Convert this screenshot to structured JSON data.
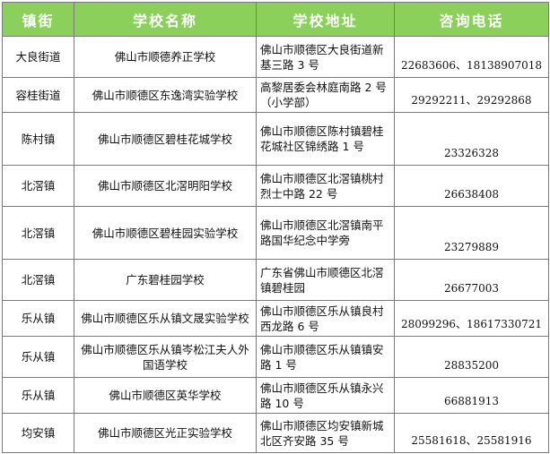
{
  "headers": [
    "镇街",
    "学校名称",
    "学校地址",
    "咨询电话"
  ],
  "rows": [
    {
      "town": "大良街道",
      "school": "佛山市顺德养正学校",
      "address": "佛山市顺德区大良街道新基三路 3 号",
      "phone": "22683606、18138907018"
    },
    {
      "town": "容桂街道",
      "school": "佛山市顺德区东逸湾实验学校",
      "address": "高黎居委会林庭南路 2 号（小学部）",
      "phone": "29292211、29292868"
    },
    {
      "town": "陈村镇",
      "school": "佛山市顺德区碧桂花城学校",
      "address": "佛山市顺德区陈村镇碧桂花城社区锦绣路 1 号",
      "phone": "23326328"
    },
    {
      "town": "北滘镇",
      "school": "佛山市顺德区北滘明阳学校",
      "address": "佛山市顺德区北滘镇桃村烈士中路 22 号",
      "phone": "26638408"
    },
    {
      "town": "北滘镇",
      "school": "佛山市顺德区碧桂园实验学校",
      "address": "佛山市顺德区北滘镇南平路国华纪念中学旁",
      "phone": "23279889"
    },
    {
      "town": "北滘镇",
      "school": "广东碧桂园学校",
      "address": "广东省佛山市顺德区北滘镇碧桂园",
      "phone": "26677003"
    },
    {
      "town": "乐从镇",
      "school": "佛山市顺德区乐从镇文晟实验学校",
      "address": "佛山市顺德区乐从镇良村西龙路 6 号",
      "phone": "28099296、18617330721"
    },
    {
      "town": "乐从镇",
      "school": "佛山市顺德区乐从镇岑松江夫人外国语学校",
      "address": "佛山市顺德区乐从镇镇安路 1 号",
      "phone": "28835200"
    },
    {
      "town": "乐从镇",
      "school": "佛山市顺德区英华学校",
      "address": "佛山市顺德区乐从镇永兴路 10 号",
      "phone": "66881913"
    },
    {
      "town": "均安镇",
      "school": "佛山市顺德区光正实验学校",
      "address": "佛山市顺德区均安镇新城北区齐安路 35 号",
      "phone": "25581618、25581916"
    }
  ]
}
